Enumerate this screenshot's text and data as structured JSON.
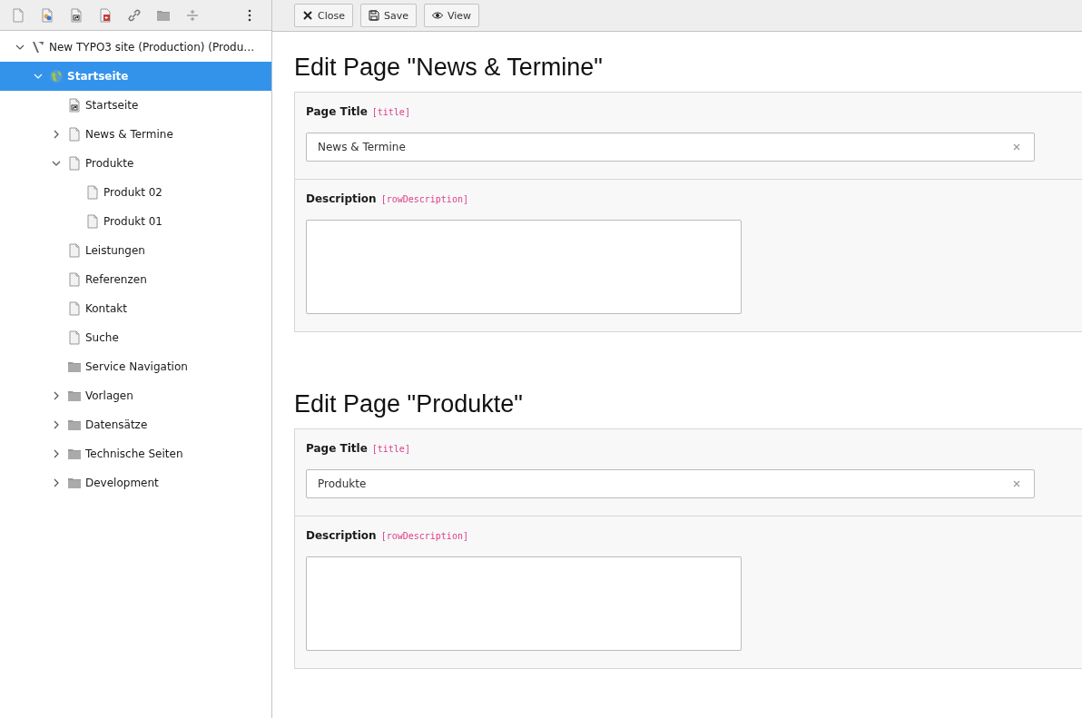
{
  "toolbar": {
    "buttons": [
      {
        "label": "Close",
        "kind": "close"
      },
      {
        "label": "Save",
        "kind": "save"
      },
      {
        "label": "View",
        "kind": "view"
      }
    ]
  },
  "tree": {
    "items": [
      {
        "label": "New TYPO3 site (Production) (Produ…",
        "kind": "site",
        "expanded": true,
        "selected": false,
        "children": [
          {
            "label": "Startseite",
            "kind": "globe",
            "expanded": true,
            "selected": true,
            "children": [
              {
                "label": "Startseite",
                "kind": "shortcut",
                "selected": false
              },
              {
                "label": "News & Termine",
                "kind": "page",
                "expanded": false,
                "selected": false
              },
              {
                "label": "Produkte",
                "kind": "page",
                "expanded": true,
                "selected": false,
                "children": [
                  {
                    "label": "Produkt 02",
                    "kind": "page",
                    "selected": false
                  },
                  {
                    "label": "Produkt 01",
                    "kind": "page",
                    "selected": false
                  }
                ]
              },
              {
                "label": "Leistungen",
                "kind": "page",
                "selected": false
              },
              {
                "label": "Referenzen",
                "kind": "page",
                "selected": false
              },
              {
                "label": "Kontakt",
                "kind": "page",
                "selected": false
              },
              {
                "label": "Suche",
                "kind": "page",
                "selected": false
              },
              {
                "label": "Service Navigation",
                "kind": "folder",
                "selected": false
              },
              {
                "label": "Vorlagen",
                "kind": "folder",
                "expanded": false,
                "selected": false
              },
              {
                "label": "Datensätze",
                "kind": "folder",
                "expanded": false,
                "selected": false
              },
              {
                "label": "Technische Seiten",
                "kind": "folder",
                "expanded": false,
                "selected": false
              },
              {
                "label": "Development",
                "kind": "folder",
                "expanded": false,
                "selected": false
              }
            ]
          }
        ]
      }
    ]
  },
  "records": [
    {
      "heading": "Edit Page \"News & Termine\"",
      "fields": [
        {
          "label": "Page Title",
          "field_name": "[title]",
          "kind": "input",
          "value": "News & Termine"
        },
        {
          "label": "Description",
          "field_name": "[rowDescription]",
          "kind": "textarea"
        }
      ]
    },
    {
      "heading": "Edit Page \"Produkte\"",
      "fields": [
        {
          "label": "Page Title",
          "field_name": "[title]",
          "kind": "input",
          "value": "Produkte"
        },
        {
          "label": "Description",
          "field_name": "[rowDescription]",
          "kind": "textarea"
        }
      ]
    }
  ]
}
